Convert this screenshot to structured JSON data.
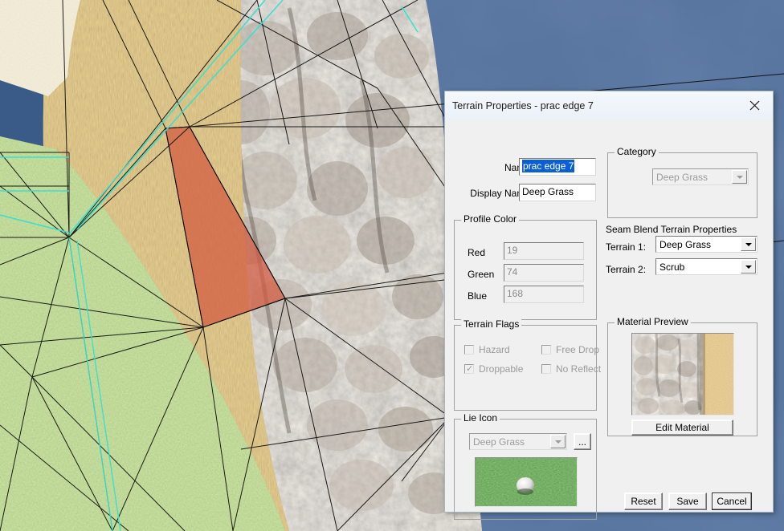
{
  "viewport": {
    "name": "terrain-3d-viewport",
    "description": "3D golf course terrain editor viewport with wireframe mesh overlay",
    "colors": {
      "water": "#3a5a88",
      "water_dark": "#2f4a74",
      "rock": "#a39a90",
      "dry_grass": "#c49a63",
      "pale_sand": "#e8e2cc",
      "green_grass": "#8fae68",
      "selected_polygon": "#d05a42",
      "wireframe": "#000000",
      "highlight_edge": "#35e0d0"
    }
  },
  "dialog": {
    "title": "Terrain Properties - prac edge 7",
    "close_icon": "close-icon",
    "fields": {
      "name_label": "Name",
      "name_value": "prac edge 7",
      "name_selected": true,
      "display_name_label": "Display Name",
      "display_name_value": "Deep Grass"
    },
    "category": {
      "legend": "Category",
      "value": "Deep Grass",
      "disabled": true
    },
    "seam_blend": {
      "heading": "Seam Blend Terrain Properties",
      "terrain1_label": "Terrain 1:",
      "terrain1_value": "Deep Grass",
      "terrain2_label": "Terrain 2:",
      "terrain2_value": "Scrub"
    },
    "profile_color": {
      "legend": "Profile Color",
      "red_label": "Red",
      "red_value": "19",
      "green_label": "Green",
      "green_value": "74",
      "blue_label": "Blue",
      "blue_value": "168",
      "disabled": true
    },
    "terrain_flags": {
      "legend": "Terrain Flags",
      "items": [
        {
          "label": "Hazard",
          "checked": false,
          "disabled": true
        },
        {
          "label": "Free Drop",
          "checked": false,
          "disabled": true
        },
        {
          "label": "Droppable",
          "checked": true,
          "disabled": true
        },
        {
          "label": "No Reflect",
          "checked": false,
          "disabled": true
        }
      ]
    },
    "lie_icon": {
      "legend": "Lie Icon",
      "value": "Deep Grass",
      "browse_label": "...",
      "preview_alt": "grass-with-golf-ball-preview"
    },
    "material_preview": {
      "legend": "Material Preview",
      "preview_alt": "rock-and-sand-texture-preview",
      "edit_label": "Edit Material"
    },
    "buttons": {
      "reset": "Reset",
      "save": "Save",
      "cancel": "Cancel",
      "focused": "Cancel"
    }
  }
}
